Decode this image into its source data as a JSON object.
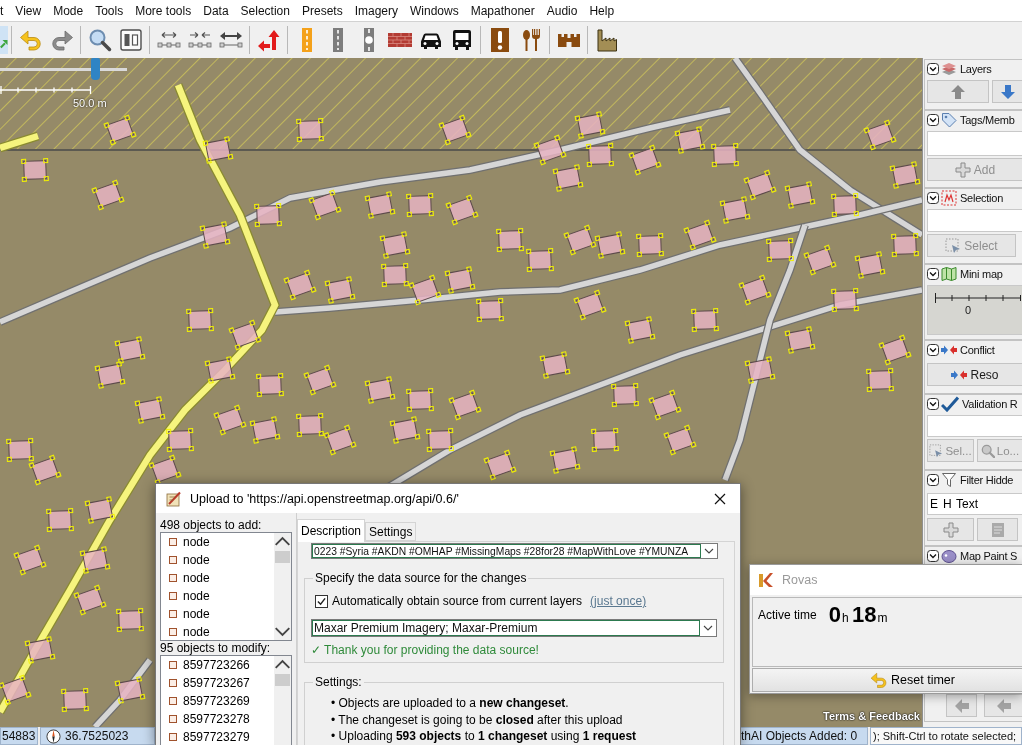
{
  "menu_bar": {
    "items": [
      "t",
      "View",
      "Mode",
      "Tools",
      "More tools",
      "Data",
      "Selection",
      "Presets",
      "Imagery",
      "Windows",
      "Mapathoner",
      "Audio",
      "Help"
    ]
  },
  "map": {
    "zoom_slider": {
      "level": 0.75
    },
    "scale_label": "50.0 m",
    "attribution": "Terms & Feedback"
  },
  "side_panel": {
    "dialogs": [
      {
        "kind": "layers",
        "title": "Layers"
      },
      {
        "kind": "tags",
        "title": "Tags/Memb",
        "buttons": [
          {
            "label": "Add",
            "disabled": true
          }
        ]
      },
      {
        "kind": "selection",
        "title": "Selection",
        "buttons": [
          {
            "label": "Select",
            "disabled": true
          }
        ]
      },
      {
        "kind": "minimap",
        "title": "Mini map",
        "scale_label": "0"
      },
      {
        "kind": "conflict",
        "title": "Conflict",
        "buttons": [
          {
            "label": "Reso",
            "disabled": false
          }
        ]
      },
      {
        "kind": "validation",
        "title": "Validation R",
        "buttons": [
          {
            "label": "Sel...",
            "disabled": true
          },
          {
            "label": "Lo...",
            "disabled": true
          }
        ]
      },
      {
        "kind": "filter",
        "title": "Filter Hidde",
        "columns": [
          "E",
          "H",
          "Text"
        ]
      },
      {
        "kind": "paint",
        "title": "Map Paint S"
      }
    ]
  },
  "upload_dialog": {
    "title": "Upload to 'https://api.openstreetmap.org/api/0.6/'",
    "focused": true,
    "lists": [
      {
        "label": "498 objects to add:",
        "items": [
          "node",
          "node",
          "node",
          "node",
          "node",
          "node"
        ]
      },
      {
        "label": "95 objects to modify:",
        "items": [
          "8597723266",
          "8597723267",
          "8597723269",
          "8597723278",
          "8597723279"
        ]
      }
    ],
    "tabs": [
      {
        "label": "Description",
        "selected": true
      },
      {
        "label": "Settings",
        "selected": false
      }
    ],
    "comment": "0223 #Syria #AKDN #OMHAP #MissingMaps #28for28 #MapWithLove #YMUNZA",
    "source_group": {
      "title": "Specify the data source for the changes",
      "auto_source": {
        "label": "Automatically obtain source from current layers",
        "checked": true
      },
      "link": "(just once)",
      "source": "Maxar Premium Imagery; Maxar-Premium",
      "confirmation": "✓ Thank you for providing the data source!"
    },
    "settings_group": {
      "title": "Settings:",
      "bullets": [
        "• Objects are uploaded to a **new changeset**.",
        "• The changeset is going to be **closed** after this upload",
        "• Uploading **593 objects** to **1 changeset** using **1 request**"
      ]
    }
  },
  "rovas_window": {
    "title": "Rovas",
    "focused": false,
    "label": "Active time",
    "hours": "0",
    "hours_unit": "h",
    "minutes": "18",
    "minutes_unit": "m",
    "button": "Reset timer"
  },
  "status_bar": {
    "longitude": "54883",
    "latitude": "36.7525023",
    "objects_added": "thAI Objects Added: 0",
    "hint": "); Shift-Ctrl to rotate selected;"
  }
}
